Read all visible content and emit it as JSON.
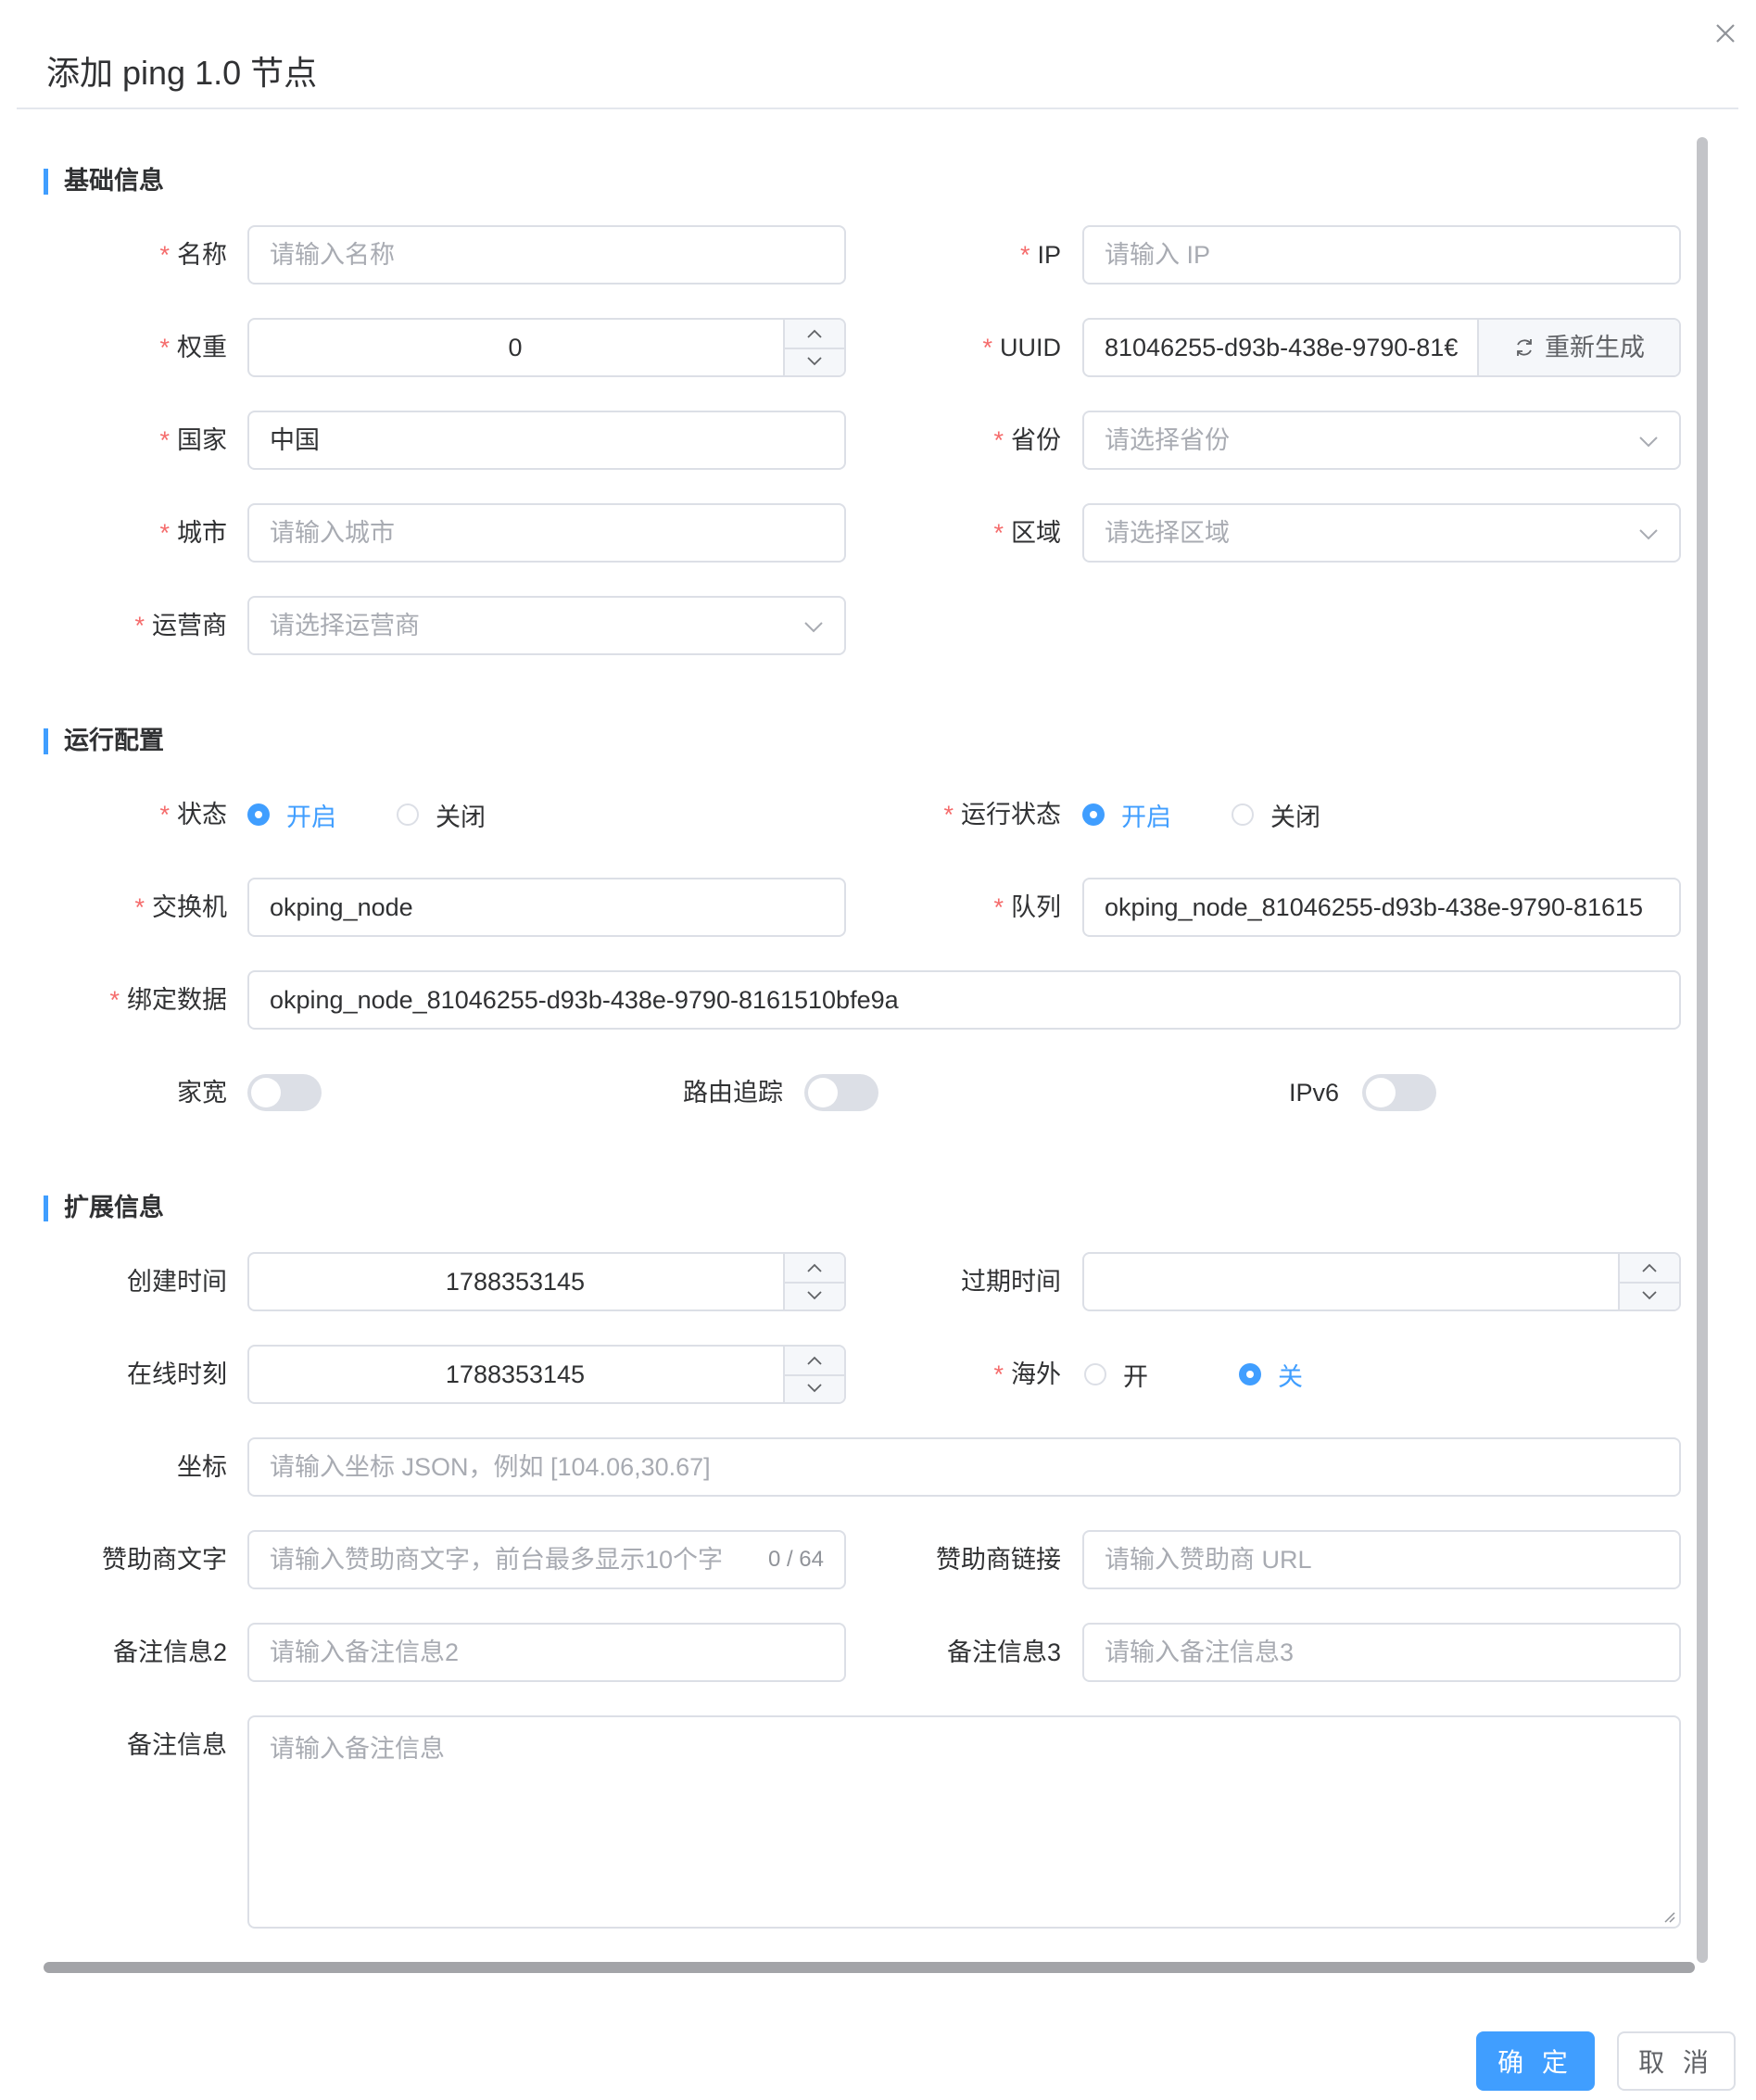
{
  "dialog": {
    "title": "添加 ping 1.0 节点"
  },
  "sections": {
    "basic": "基础信息",
    "runtime": "运行配置",
    "extended": "扩展信息"
  },
  "fields": {
    "name": {
      "label": "名称",
      "placeholder": "请输入名称"
    },
    "ip": {
      "label": "IP",
      "placeholder": "请输入 IP"
    },
    "weight": {
      "label": "权重",
      "value": "0"
    },
    "uuid": {
      "label": "UUID",
      "value": "81046255-d93b-438e-9790-81€",
      "button": "重新生成"
    },
    "country": {
      "label": "国家",
      "value": "中国"
    },
    "province": {
      "label": "省份",
      "placeholder": "请选择省份"
    },
    "city": {
      "label": "城市",
      "placeholder": "请输入城市"
    },
    "region": {
      "label": "区域",
      "placeholder": "请选择区域"
    },
    "carrier": {
      "label": "运营商",
      "placeholder": "请选择运营商"
    },
    "status": {
      "label": "状态",
      "options": [
        "开启",
        "关闭"
      ],
      "selected": "开启"
    },
    "run_status": {
      "label": "运行状态",
      "options": [
        "开启",
        "关闭"
      ],
      "selected": "开启"
    },
    "exchange": {
      "label": "交换机",
      "value": "okping_node"
    },
    "queue": {
      "label": "队列",
      "value": "okping_node_81046255-d93b-438e-9790-81615"
    },
    "binding": {
      "label": "绑定数据",
      "value": "okping_node_81046255-d93b-438e-9790-8161510bfe9a"
    },
    "broadband": {
      "label": "家宽",
      "enabled": false
    },
    "traceroute": {
      "label": "路由追踪",
      "enabled": false
    },
    "ipv6": {
      "label": "IPv6",
      "enabled": false
    },
    "created_time": {
      "label": "创建时间",
      "value": "1788353145"
    },
    "expire_time": {
      "label": "过期时间",
      "value": ""
    },
    "online_time": {
      "label": "在线时刻",
      "value": "1788353145"
    },
    "overseas": {
      "label": "海外",
      "options": [
        "开",
        "关"
      ],
      "selected": "关"
    },
    "coords": {
      "label": "坐标",
      "placeholder": "请输入坐标 JSON，例如 [104.06,30.67]"
    },
    "sponsor_text": {
      "label": "赞助商文字",
      "placeholder": "请输入赞助商文字，前台最多显示10个字",
      "counter": "0 / 64"
    },
    "sponsor_link": {
      "label": "赞助商链接",
      "placeholder": "请输入赞助商 URL"
    },
    "remark2": {
      "label": "备注信息2",
      "placeholder": "请输入备注信息2"
    },
    "remark3": {
      "label": "备注信息3",
      "placeholder": "请输入备注信息3"
    },
    "remark": {
      "label": "备注信息",
      "placeholder": "请输入备注信息"
    }
  },
  "footer": {
    "confirm": "确 定",
    "cancel": "取 消"
  },
  "colors": {
    "primary": "#409eff",
    "required": "#f56c6c",
    "border": "#dcdfe6",
    "placeholder": "#a8abb2"
  }
}
